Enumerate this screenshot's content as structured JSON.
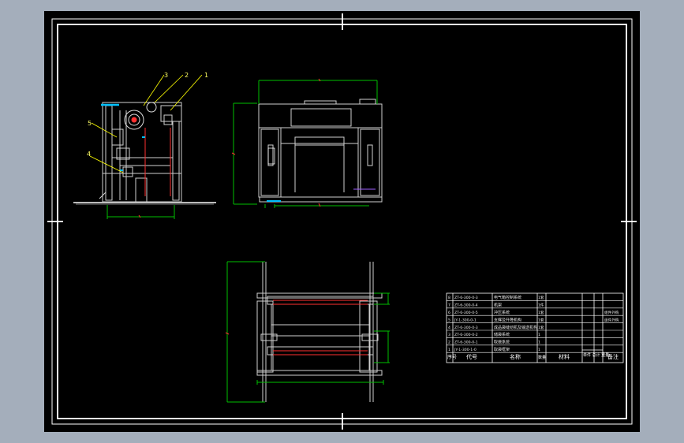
{
  "balloons": {
    "b1": "1",
    "b2": "2",
    "b3": "3",
    "b4": "4",
    "b5": "5"
  },
  "bom": {
    "header": {
      "no": "序号",
      "code": "代号",
      "name": "名称",
      "qty": "数量",
      "material": "材料",
      "weight": "单件 总计 重量",
      "remark": "备注"
    },
    "rows": [
      {
        "no": "8",
        "code": "ZT-6-300-0-3",
        "name": "电气箱控制系统",
        "qty": "1套",
        "remark": ""
      },
      {
        "no": "7",
        "code": "ZT-6-300-0-4",
        "name": "机架",
        "qty": "1件",
        "remark": ""
      },
      {
        "no": "6",
        "code": "ZT-6-300-0-5",
        "name": "冲压系统",
        "qty": "1套",
        "remark": "组件外购"
      },
      {
        "no": "5",
        "code": "JY-1-300-0-1",
        "name": "支撑及升降机构",
        "qty": "1套",
        "remark": "组件外购"
      },
      {
        "no": "4",
        "code": "ZT-6-300-0-3",
        "name": "成品袋缝纫机及输送机构",
        "qty": "1套",
        "remark": ""
      },
      {
        "no": "3",
        "code": "ZT-6-300-0-2",
        "name": "储袋系统",
        "qty": "1",
        "remark": ""
      },
      {
        "no": "2",
        "code": "ZT-6-300-0-1",
        "name": "取袋系统",
        "qty": "1",
        "remark": ""
      },
      {
        "no": "1",
        "code": "JY-1-300-1-0",
        "name": "取袋框架",
        "qty": "1",
        "remark": ""
      }
    ]
  },
  "colors": {
    "background": "#000000",
    "outer": "#a4aebb",
    "frame": "#ffffff",
    "dimension": "#00c000",
    "balloon": "#ffff00",
    "hidden": "#ff3030",
    "accent": "#00c0ff"
  }
}
